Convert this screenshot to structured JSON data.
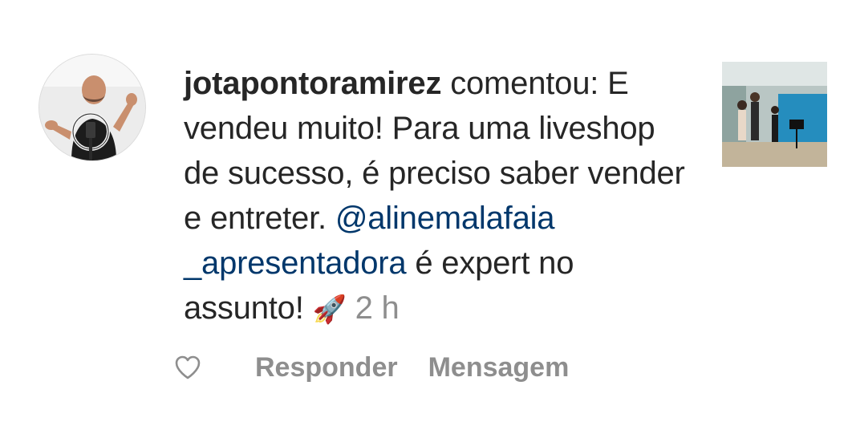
{
  "comment": {
    "username": "jotapontoramirez",
    "text_before": " comentou: E vendeu muito! Para uma liveshop de sucesso, é preciso saber vender e entreter. ",
    "mention": "@alinemalafaia _apresentadora",
    "text_after": " é expert no assunto! ",
    "emoji": "🚀",
    "time": "2 h"
  },
  "actions": {
    "reply_label": "Responder",
    "message_label": "Mensagem"
  },
  "icons": {
    "like": "heart-outline-icon"
  },
  "colors": {
    "text": "#262626",
    "mention": "#00376b",
    "muted": "#8e8e8e"
  }
}
